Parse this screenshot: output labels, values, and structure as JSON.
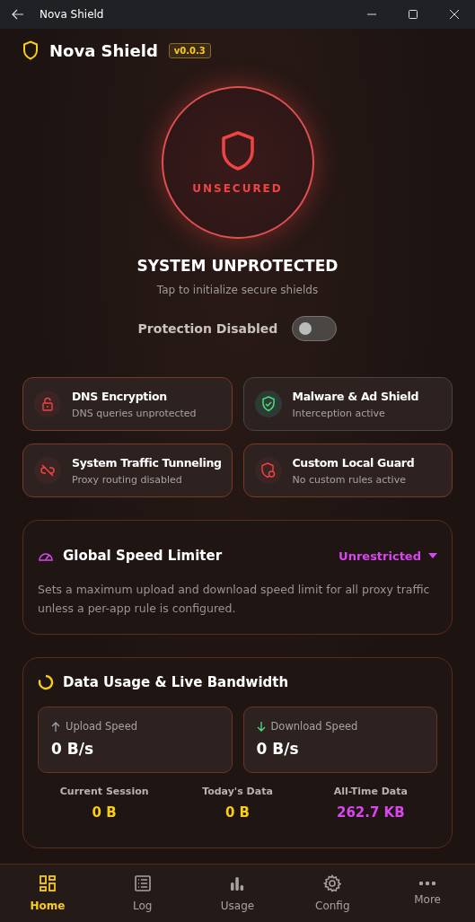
{
  "window": {
    "title": "Nova Shield"
  },
  "header": {
    "title": "Nova Shield",
    "version": "v0.0.3"
  },
  "status": {
    "protected": false,
    "badge": "UNSECURED",
    "title": "SYSTEM UNPROTECTED",
    "subtitle": "Tap to initialize secure shields"
  },
  "protection_toggle": {
    "label": "Protection Disabled",
    "on": false
  },
  "features": [
    {
      "kind": "lock",
      "title": "DNS Encryption",
      "detail": "DNS queries unprotected",
      "active": false
    },
    {
      "kind": "shield-check",
      "title": "Malware & Ad Shield",
      "detail": "Interception active",
      "active": true
    },
    {
      "kind": "unlink",
      "title": "System Traffic Tunneling",
      "detail": "Proxy routing disabled",
      "active": false
    },
    {
      "kind": "shield-user",
      "title": "Custom Local Guard",
      "detail": "No custom rules active",
      "active": false
    }
  ],
  "speed_limiter": {
    "title": "Global Speed Limiter",
    "value": "Unrestricted",
    "description": "Sets a maximum upload and download speed limit for all proxy traffic unless a per-app rule is configured."
  },
  "data_usage": {
    "title": "Data Usage & Live Bandwidth",
    "speeds": [
      {
        "kind": "upload",
        "label": "Upload Speed",
        "value": "0 B/s"
      },
      {
        "kind": "download",
        "label": "Download Speed",
        "value": "0 B/s"
      }
    ],
    "totals": [
      {
        "label": "Current Session",
        "value": "0 B",
        "color": "#facc15"
      },
      {
        "label": "Today's Data",
        "value": "0 B",
        "color": "#facc15"
      },
      {
        "label": "All-Time Data",
        "value": "262.7 KB",
        "color": "#d946ef"
      }
    ]
  },
  "nav": [
    {
      "kind": "home",
      "label": "Home",
      "selected": true
    },
    {
      "kind": "log",
      "label": "Log",
      "selected": false
    },
    {
      "kind": "usage",
      "label": "Usage",
      "selected": false
    },
    {
      "kind": "config",
      "label": "Config",
      "selected": false
    },
    {
      "kind": "more",
      "label": "More",
      "selected": false
    }
  ]
}
